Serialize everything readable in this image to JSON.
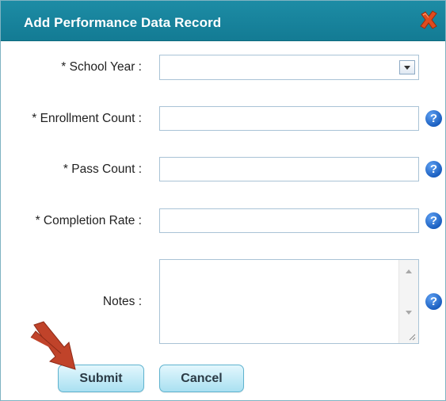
{
  "dialog": {
    "title": "Add Performance Data Record",
    "close_icon": "close-x-icon"
  },
  "form": {
    "school_year": {
      "label": "* School Year :",
      "value": ""
    },
    "enrollment_count": {
      "label": "* Enrollment Count :",
      "value": ""
    },
    "pass_count": {
      "label": "* Pass Count :",
      "value": ""
    },
    "completion_rate": {
      "label": "* Completion Rate :",
      "value": ""
    },
    "notes": {
      "label": "Notes :",
      "value": ""
    },
    "help_glyph": "?"
  },
  "buttons": {
    "submit": "Submit",
    "cancel": "Cancel"
  },
  "colors": {
    "titlebar": "#1d8ca5",
    "button": "#a9e0f1",
    "help_icon": "#1b5fc0",
    "annotation_arrow": "#c0432a"
  }
}
